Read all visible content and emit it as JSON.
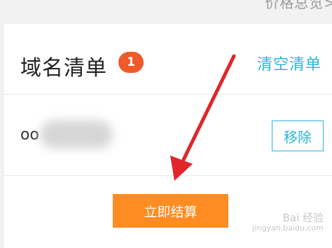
{
  "header": {
    "link_label": "价格总览>"
  },
  "cart": {
    "title": "域名清单",
    "count": "1",
    "clear_label": "清空清单"
  },
  "item": {
    "domain_visible": "oo",
    "remove_label": "移除"
  },
  "checkout": {
    "label": "立即结算"
  },
  "watermark": {
    "brand": "Bai 经验",
    "url": "jingyan.baidu.com"
  },
  "colors": {
    "accent_blue": "#2cb5d8",
    "badge_red": "#ef5a2a",
    "checkout_orange": "#ff8c22",
    "annotation_arrow": "#e0262a"
  }
}
